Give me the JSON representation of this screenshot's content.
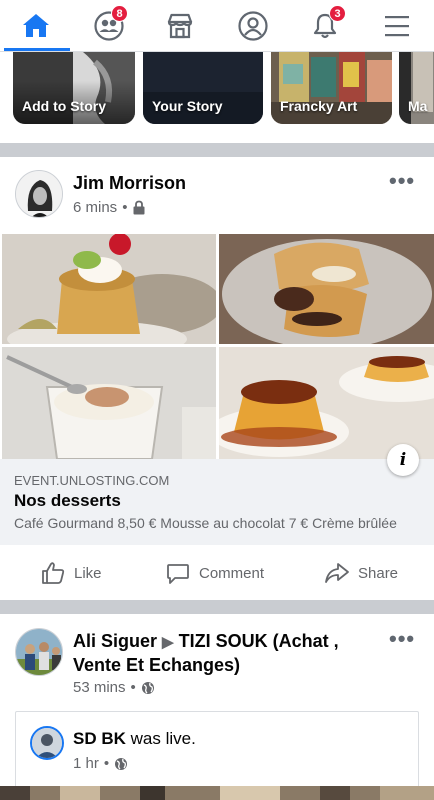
{
  "nav": {
    "items": [
      {
        "name": "home",
        "icon": "home-icon",
        "active": true
      },
      {
        "name": "friends",
        "icon": "friends-icon",
        "badge": "8"
      },
      {
        "name": "marketplace",
        "icon": "marketplace-icon"
      },
      {
        "name": "profile",
        "icon": "profile-icon"
      },
      {
        "name": "notifications",
        "icon": "bell-icon",
        "badge": "3"
      },
      {
        "name": "menu",
        "icon": "hamburger-icon"
      }
    ],
    "accent": "#1877f2",
    "badge_color": "#e41e3f"
  },
  "stories": [
    {
      "label": "Add to Story"
    },
    {
      "label": "Your Story"
    },
    {
      "label": "Francky Art"
    },
    {
      "label": "Ma"
    }
  ],
  "post1": {
    "author": "Jim Morrison",
    "time": "6 mins",
    "privacy_icon": "lock-icon",
    "link": {
      "domain": "EVENT.UNLOSTING.COM",
      "title": "Nos desserts",
      "description": "Café Gourmand 8,50 € Mousse au chocolat 7 € Crème brûlée"
    },
    "info_label": "i"
  },
  "actions": {
    "like": "Like",
    "comment": "Comment",
    "share": "Share"
  },
  "post2": {
    "author": "Ali Siguer",
    "group": "TIZI SOUK (Achat , Vente Et Echanges)",
    "time": "53 mins",
    "privacy_icon": "globe-icon",
    "shared": {
      "author": "SD BK",
      "action": "was live.",
      "time": "1 hr",
      "privacy_icon": "globe-icon"
    }
  }
}
